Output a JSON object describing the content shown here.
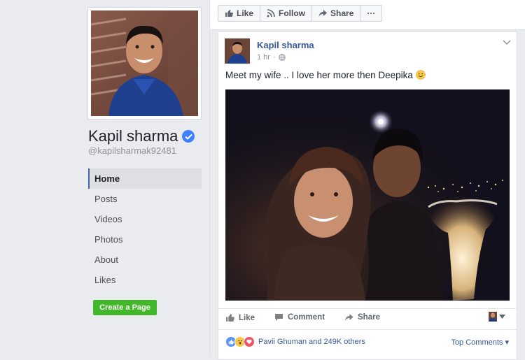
{
  "page": {
    "name": "Kapil sharma",
    "username": "@kapilsharmak92481",
    "nav": [
      "Home",
      "Posts",
      "Videos",
      "Photos",
      "About",
      "Likes"
    ],
    "create_page_label": "Create a Page"
  },
  "action_bar": {
    "like_label": "Like",
    "follow_label": "Follow",
    "share_label": "Share",
    "more_label": "···"
  },
  "post": {
    "author": "Kapil sharma",
    "time": "1 hr",
    "audience_icon": "globe-icon",
    "text": "Meet my wife .. I love her more then Deepika",
    "actions": {
      "like": "Like",
      "comment": "Comment",
      "share": "Share"
    },
    "reactions": {
      "icons": [
        "like",
        "wow",
        "love"
      ],
      "summary": "Pavii Ghuman and 249K others"
    },
    "top_comments_label": "Top Comments ▾"
  },
  "colors": {
    "facebook_blue": "#4267b2",
    "link_blue": "#365899",
    "create_green": "#42b72a",
    "verified_blue": "#4080ff"
  }
}
